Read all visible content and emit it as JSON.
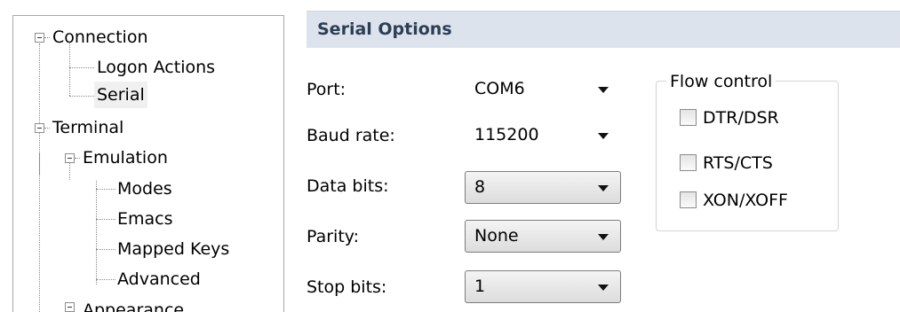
{
  "tree": {
    "items": [
      {
        "label": "Connection"
      },
      {
        "label": "Logon Actions"
      },
      {
        "label": "Serial"
      },
      {
        "label": "Terminal"
      },
      {
        "label": "Emulation"
      },
      {
        "label": "Modes"
      },
      {
        "label": "Emacs"
      },
      {
        "label": "Mapped Keys"
      },
      {
        "label": "Advanced"
      },
      {
        "label": "Appearance"
      }
    ],
    "selected": "Serial"
  },
  "panel": {
    "title": "Serial Options",
    "fields": {
      "port": {
        "label": "Port:",
        "value": "COM6"
      },
      "baud": {
        "label": "Baud rate:",
        "value": "115200"
      },
      "data_bits": {
        "label": "Data bits:",
        "value": "8"
      },
      "parity": {
        "label": "Parity:",
        "value": "None"
      },
      "stop_bits": {
        "label": "Stop bits:",
        "value": "1"
      }
    },
    "flow_control": {
      "legend": "Flow control",
      "options": [
        {
          "label": "DTR/DSR",
          "checked": false
        },
        {
          "label": "RTS/CTS",
          "checked": false
        },
        {
          "label": "XON/XOFF",
          "checked": false
        }
      ]
    }
  },
  "colors": {
    "header_bg": "#dde3ec",
    "header_text": "#2d3e55",
    "tree_border": "#a8a8a8"
  }
}
